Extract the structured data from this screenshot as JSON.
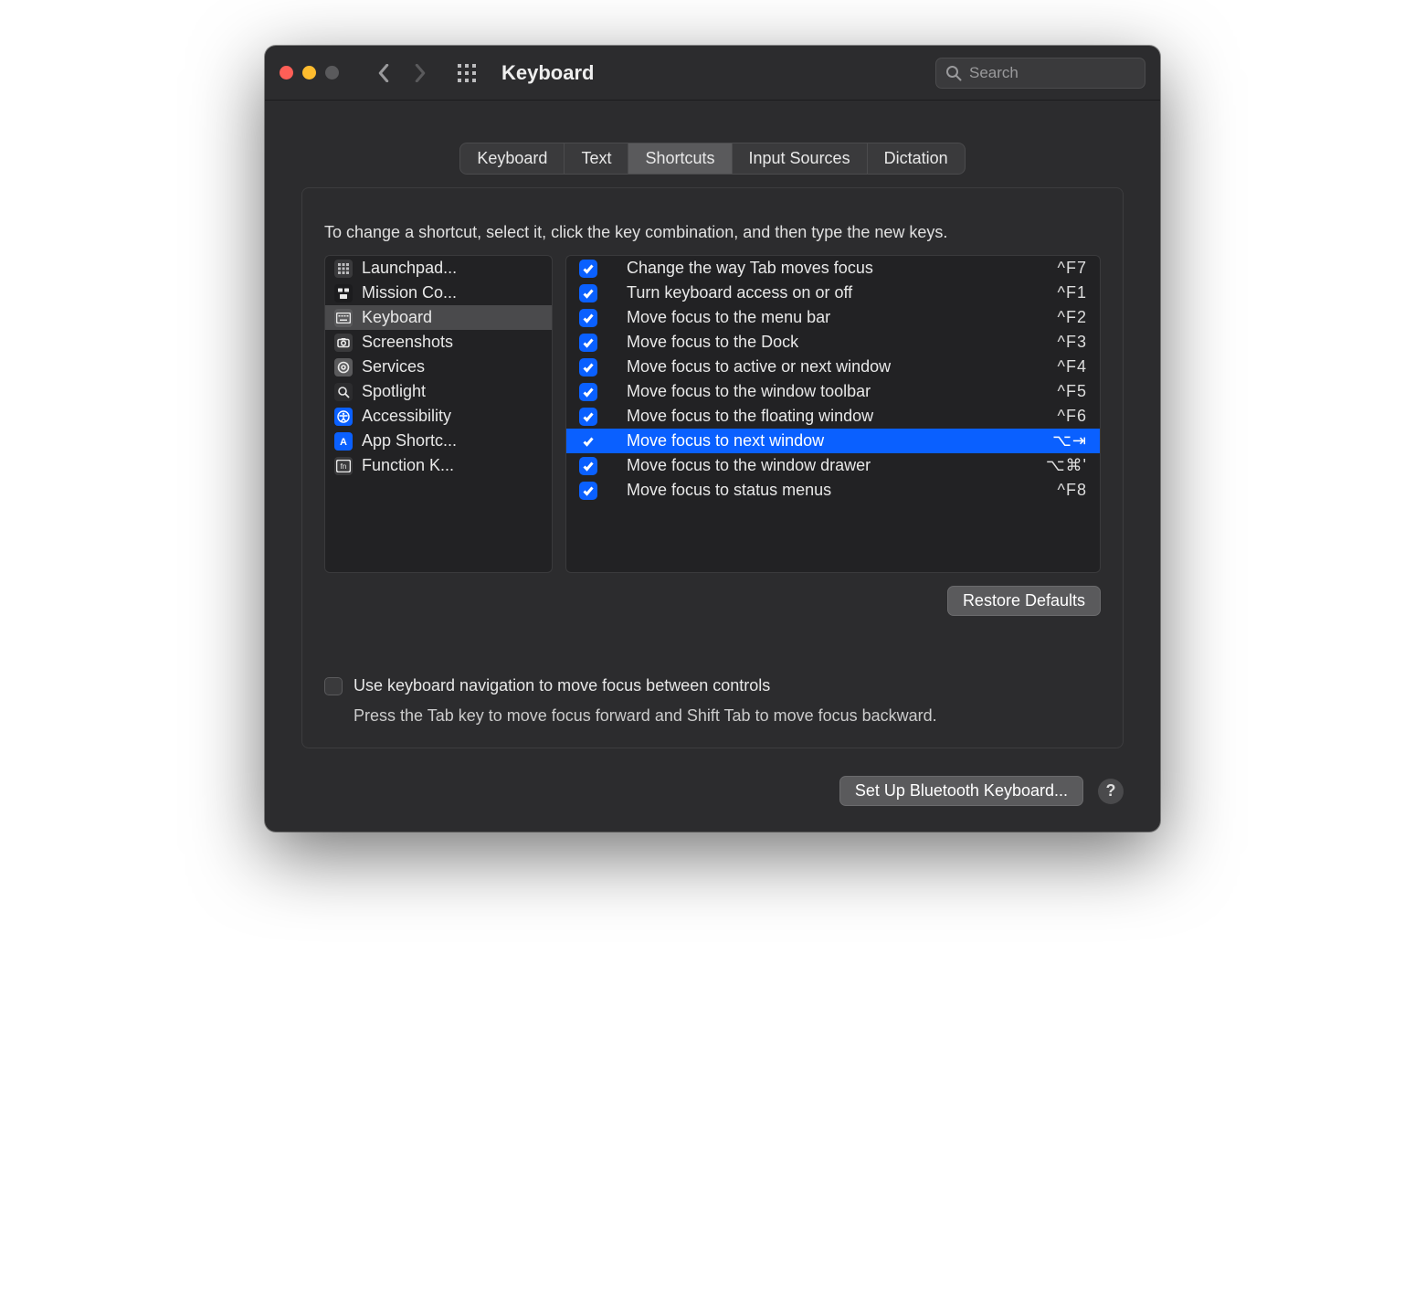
{
  "window": {
    "title": "Keyboard",
    "searchPlaceholder": "Search"
  },
  "tabs": [
    {
      "label": "Keyboard"
    },
    {
      "label": "Text"
    },
    {
      "label": "Shortcuts"
    },
    {
      "label": "Input Sources"
    },
    {
      "label": "Dictation"
    }
  ],
  "activeTabIndex": 2,
  "instruction": "To change a shortcut, select it, click the key combination, and then type the new keys.",
  "categories": [
    {
      "icon": "launchpad-icon",
      "label": "Launchpad..."
    },
    {
      "icon": "mission-control-icon",
      "label": "Mission Co..."
    },
    {
      "icon": "keyboard-icon",
      "label": "Keyboard"
    },
    {
      "icon": "screenshots-icon",
      "label": "Screenshots"
    },
    {
      "icon": "services-icon",
      "label": "Services"
    },
    {
      "icon": "spotlight-icon",
      "label": "Spotlight"
    },
    {
      "icon": "accessibility-icon",
      "label": "Accessibility"
    },
    {
      "icon": "app-shortcuts-icon",
      "label": "App Shortc..."
    },
    {
      "icon": "function-keys-icon",
      "label": "Function K..."
    }
  ],
  "selectedCategoryIndex": 2,
  "shortcuts": [
    {
      "checked": true,
      "label": "Change the way Tab moves focus",
      "key": "^F7"
    },
    {
      "checked": true,
      "label": "Turn keyboard access on or off",
      "key": "^F1"
    },
    {
      "checked": true,
      "label": "Move focus to the menu bar",
      "key": "^F2"
    },
    {
      "checked": true,
      "label": "Move focus to the Dock",
      "key": "^F3"
    },
    {
      "checked": true,
      "label": "Move focus to active or next window",
      "key": "^F4"
    },
    {
      "checked": true,
      "label": "Move focus to the window toolbar",
      "key": "^F5"
    },
    {
      "checked": true,
      "label": "Move focus to the floating window",
      "key": "^F6"
    },
    {
      "checked": true,
      "label": "Move focus to next window",
      "key": "⌥⇥"
    },
    {
      "checked": true,
      "label": "Move focus to the window drawer",
      "key": "⌥⌘'"
    },
    {
      "checked": true,
      "label": "Move focus to status menus",
      "key": "^F8"
    }
  ],
  "selectedShortcutIndex": 7,
  "buttons": {
    "restoreDefaults": "Restore Defaults",
    "setupBluetooth": "Set Up Bluetooth Keyboard...",
    "help": "?"
  },
  "keyboardNav": {
    "checkboxLabel": "Use keyboard navigation to move focus between controls",
    "checked": false,
    "subText": "Press the Tab key to move focus forward and Shift Tab to move focus backward."
  },
  "catIcons": {
    "launchpad-icon": {
      "bg": "#3a3a3c",
      "fg": "#bcbcbe",
      "glyph": "grid3"
    },
    "mission-control-icon": {
      "bg": "#1c1c1e",
      "fg": "#e8e8e8",
      "glyph": "mc"
    },
    "keyboard-icon": {
      "bg": "#5a5a5c",
      "fg": "#e8e8e8",
      "glyph": "kb"
    },
    "screenshots-icon": {
      "bg": "#3a3a3c",
      "fg": "#e8e8e8",
      "glyph": "cam"
    },
    "services-icon": {
      "bg": "#5a5a5c",
      "fg": "#e8e8e8",
      "glyph": "gear"
    },
    "spotlight-icon": {
      "bg": "#2c2c2e",
      "fg": "#e8e8e8",
      "glyph": "search"
    },
    "accessibility-icon": {
      "bg": "#0a60ff",
      "fg": "#fff",
      "glyph": "a11y"
    },
    "app-shortcuts-icon": {
      "bg": "#0a60ff",
      "fg": "#fff",
      "glyph": "A"
    },
    "function-keys-icon": {
      "bg": "#3a3a3c",
      "fg": "#e8e8e8",
      "glyph": "fn"
    }
  }
}
